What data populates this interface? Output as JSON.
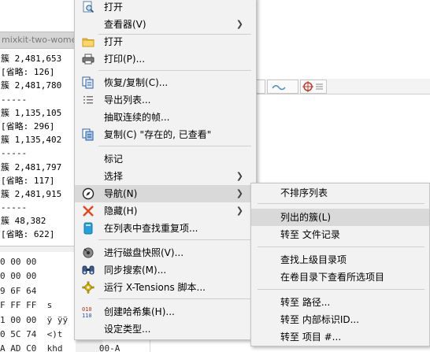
{
  "background": {
    "tab_title": "mixkit-two-wome",
    "cluster_lines": [
      "簇 2,481,653",
      "[省略: 126]",
      "簇 2,481,780",
      "-----",
      "簇 1,135,105",
      "[省略: 296]",
      "簇 1,135,402",
      "-----",
      "簇 2,481,797",
      "[省略: 117]",
      "簇 2,481,915",
      "-----",
      "簇 48,382",
      "[省略: 622]"
    ],
    "hex_rows": [
      "0 00 00",
      "0 00 00",
      "9 6F 64",
      "F FF FF  s",
      "1 00 00  ÿ ÿÿ",
      "0 5C 74  <)t",
      "A AD C0  khd       00-A"
    ]
  },
  "context_menu": {
    "items": [
      {
        "label": "打开",
        "icon": "magnifier-doc-icon"
      },
      {
        "label": "查看器(V)",
        "submenu": true
      },
      {
        "label": "打开",
        "icon": "folder-icon"
      },
      {
        "label": "打印(P)...",
        "icon": "printer-icon"
      },
      {
        "label": "恢复/复制(C)...",
        "icon": "copy-doc-icon"
      },
      {
        "label": "导出列表...",
        "icon": "export-list-icon"
      },
      {
        "label": "抽取连续的帧..."
      },
      {
        "label": "复制(C) \"存在的, 已查看\"",
        "icon": "copy-status-icon"
      },
      {
        "label": "标记"
      },
      {
        "label": "选择",
        "submenu": true
      },
      {
        "label": "导航(N)",
        "icon": "compass-icon",
        "submenu": true,
        "highlighted": true
      },
      {
        "label": "隐藏(H)",
        "icon": "red-x-icon",
        "submenu": true
      },
      {
        "label": "在列表中查找重复项...",
        "icon": "duplicate-icon"
      },
      {
        "label": "进行磁盘快照(V)...",
        "icon": "snapshot-icon"
      },
      {
        "label": "同步搜索(M)...",
        "icon": "binoculars-icon"
      },
      {
        "label": "运行 X-Tensions 脚本...",
        "icon": "gear-icon"
      },
      {
        "label": "创建哈希集(H)...",
        "icon": "hash-icon"
      },
      {
        "label": "设定类型..."
      }
    ]
  },
  "navigation_submenu": {
    "items": [
      {
        "label": "不排序列表"
      },
      {
        "label": "列出的簇(L)",
        "highlighted": true
      },
      {
        "label": "转至 文件记录"
      },
      {
        "label": "查找上级目录项"
      },
      {
        "label": "在卷目录下查看所选项目"
      },
      {
        "label": "转至 路径..."
      },
      {
        "label": "转至 内部标识ID..."
      },
      {
        "label": "转至 项目 #..."
      }
    ]
  }
}
